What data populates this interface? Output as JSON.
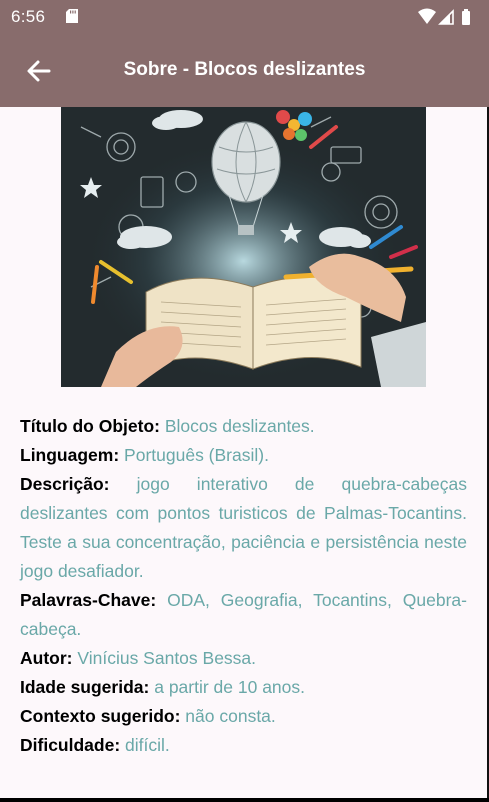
{
  "status_bar": {
    "time": "6:56"
  },
  "app_bar": {
    "title": "Sobre - Blocos deslizantes"
  },
  "details": [
    {
      "label": "Título do Objeto:",
      "value": "Blocos deslizantes."
    },
    {
      "label": "Linguagem:",
      "value": "Português (Brasil)."
    },
    {
      "label": "Descrição:",
      "value": "jogo interativo de quebra-cabeças deslizantes com pontos turisticos de Palmas-Tocantins. Teste a sua concentração, paciência e persistência neste jogo desafiador."
    },
    {
      "label": "Palavras-Chave:",
      "value": "ODA, Geografia, Tocantins, Quebra-cabeça."
    },
    {
      "label": "Autor:",
      "value": "Vinícius Santos Bessa."
    },
    {
      "label": "Idade sugerida:",
      "value": "a partir de 10 anos."
    },
    {
      "label": "Contexto sugerido:",
      "value": "não consta."
    },
    {
      "label": "Dificuldade:",
      "value": "difícil."
    }
  ],
  "colors": {
    "app_bar": "#886c6c",
    "value_text": "#6aa8a8",
    "background": "#fdf8fb"
  }
}
